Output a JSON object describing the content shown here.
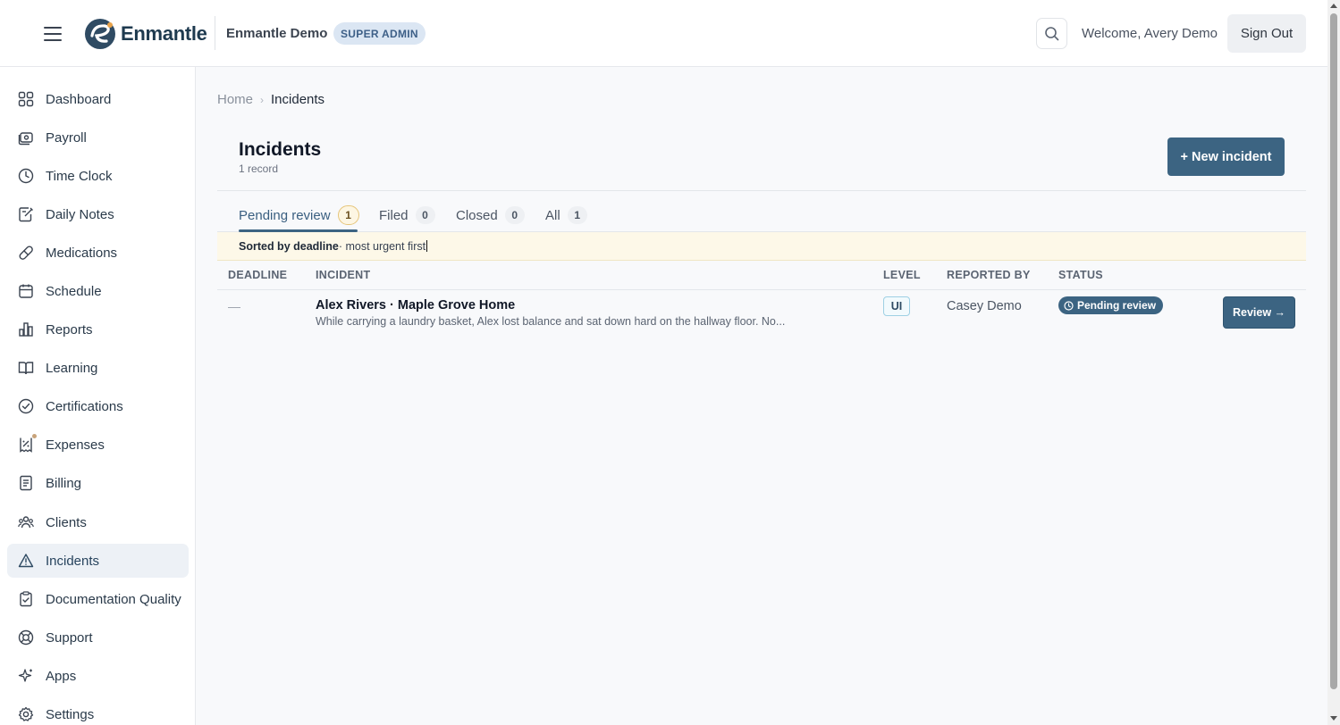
{
  "header": {
    "logo_text": "Enmantle",
    "org_name": "Enmantle Demo",
    "role_badge": "SUPER ADMIN",
    "welcome": "Welcome, Avery Demo",
    "sign_out": "Sign Out",
    "icons": {
      "menu": "hamburger-icon",
      "logo": "enmantle-logo-mark",
      "search": "search-icon"
    }
  },
  "sidebar": {
    "items": [
      {
        "label": "Dashboard",
        "icon": "grid-icon"
      },
      {
        "label": "Payroll",
        "icon": "cash-icon"
      },
      {
        "label": "Time Clock",
        "icon": "clock-icon"
      },
      {
        "label": "Daily Notes",
        "icon": "notes-icon"
      },
      {
        "label": "Medications",
        "icon": "pill-icon"
      },
      {
        "label": "Schedule",
        "icon": "calendar-icon"
      },
      {
        "label": "Reports",
        "icon": "bar-chart-icon"
      },
      {
        "label": "Learning",
        "icon": "book-icon"
      },
      {
        "label": "Certifications",
        "icon": "check-circle-icon"
      },
      {
        "label": "Expenses",
        "icon": "receipt-icon"
      },
      {
        "label": "Billing",
        "icon": "document-icon"
      },
      {
        "label": "Clients",
        "icon": "users-icon"
      },
      {
        "label": "Incidents",
        "icon": "warning-triangle-icon"
      },
      {
        "label": "Documentation Quality",
        "icon": "clipboard-check-icon"
      },
      {
        "label": "Support",
        "icon": "life-buoy-icon"
      },
      {
        "label": "Apps",
        "icon": "sparkle-icon"
      },
      {
        "label": "Settings",
        "icon": "gear-icon"
      }
    ],
    "active_index": 12
  },
  "breadcrumb": {
    "home": "Home",
    "current": "Incidents"
  },
  "page": {
    "title": "Incidents",
    "record_count": "1 record",
    "new_button": "+ New incident"
  },
  "tabs": [
    {
      "label": "Pending review",
      "count": "1"
    },
    {
      "label": "Filed",
      "count": "0"
    },
    {
      "label": "Closed",
      "count": "0"
    },
    {
      "label": "All",
      "count": "1"
    }
  ],
  "sort_banner": {
    "bold": "Sorted by deadline",
    "rest": " · most urgent first"
  },
  "table": {
    "headers": [
      "DEADLINE",
      "INCIDENT",
      "LEVEL",
      "REPORTED BY",
      "STATUS"
    ],
    "rows": [
      {
        "deadline": "—",
        "title": "Alex Rivers · Maple Grove Home",
        "description": "While carrying a laundry basket, Alex lost balance and sat down hard on the hallway floor. No...",
        "level": "UI",
        "reported_by": "Casey Demo",
        "status": "Pending review",
        "action": "Review →"
      }
    ]
  },
  "colors": {
    "primary": "#3c6482",
    "active_nav_bg": "#edf1f6",
    "role_badge_bg": "#dbe6f3",
    "sort_banner_bg": "#fdf8e8",
    "pending_count_border": "#e6c57a"
  }
}
